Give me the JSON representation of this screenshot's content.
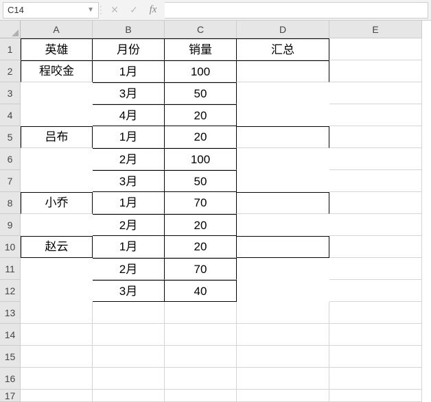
{
  "formula_bar": {
    "name_box_value": "C14",
    "cancel_label": "✕",
    "confirm_label": "✓",
    "fx_label": "fx",
    "formula_value": ""
  },
  "columns": [
    "A",
    "B",
    "C",
    "D",
    "E"
  ],
  "row_numbers": [
    "1",
    "2",
    "3",
    "4",
    "5",
    "6",
    "7",
    "8",
    "9",
    "10",
    "11",
    "12",
    "13",
    "14",
    "15",
    "16",
    "17"
  ],
  "headers": {
    "a": "英雄",
    "b": "月份",
    "c": "销量",
    "d": "汇总"
  },
  "groups": [
    {
      "name": "程咬金",
      "rows": [
        {
          "month": "1月",
          "sales": "100"
        },
        {
          "month": "3月",
          "sales": "50"
        },
        {
          "month": "4月",
          "sales": "20"
        }
      ]
    },
    {
      "name": "吕布",
      "rows": [
        {
          "month": "1月",
          "sales": "20"
        },
        {
          "month": "2月",
          "sales": "100"
        },
        {
          "month": "3月",
          "sales": "50"
        }
      ]
    },
    {
      "name": "小乔",
      "rows": [
        {
          "month": "1月",
          "sales": "70"
        },
        {
          "month": "2月",
          "sales": "20"
        }
      ]
    },
    {
      "name": "赵云",
      "rows": [
        {
          "month": "1月",
          "sales": "20"
        },
        {
          "month": "2月",
          "sales": "70"
        },
        {
          "month": "3月",
          "sales": "40"
        }
      ]
    }
  ],
  "chart_data": {
    "type": "table",
    "title": "",
    "columns": [
      "英雄",
      "月份",
      "销量",
      "汇总"
    ],
    "rows": [
      [
        "程咬金",
        "1月",
        100,
        null
      ],
      [
        "程咬金",
        "3月",
        50,
        null
      ],
      [
        "程咬金",
        "4月",
        20,
        null
      ],
      [
        "吕布",
        "1月",
        20,
        null
      ],
      [
        "吕布",
        "2月",
        100,
        null
      ],
      [
        "吕布",
        "3月",
        50,
        null
      ],
      [
        "小乔",
        "1月",
        70,
        null
      ],
      [
        "小乔",
        "2月",
        20,
        null
      ],
      [
        "赵云",
        "1月",
        20,
        null
      ],
      [
        "赵云",
        "2月",
        70,
        null
      ],
      [
        "赵云",
        "3月",
        40,
        null
      ]
    ]
  }
}
